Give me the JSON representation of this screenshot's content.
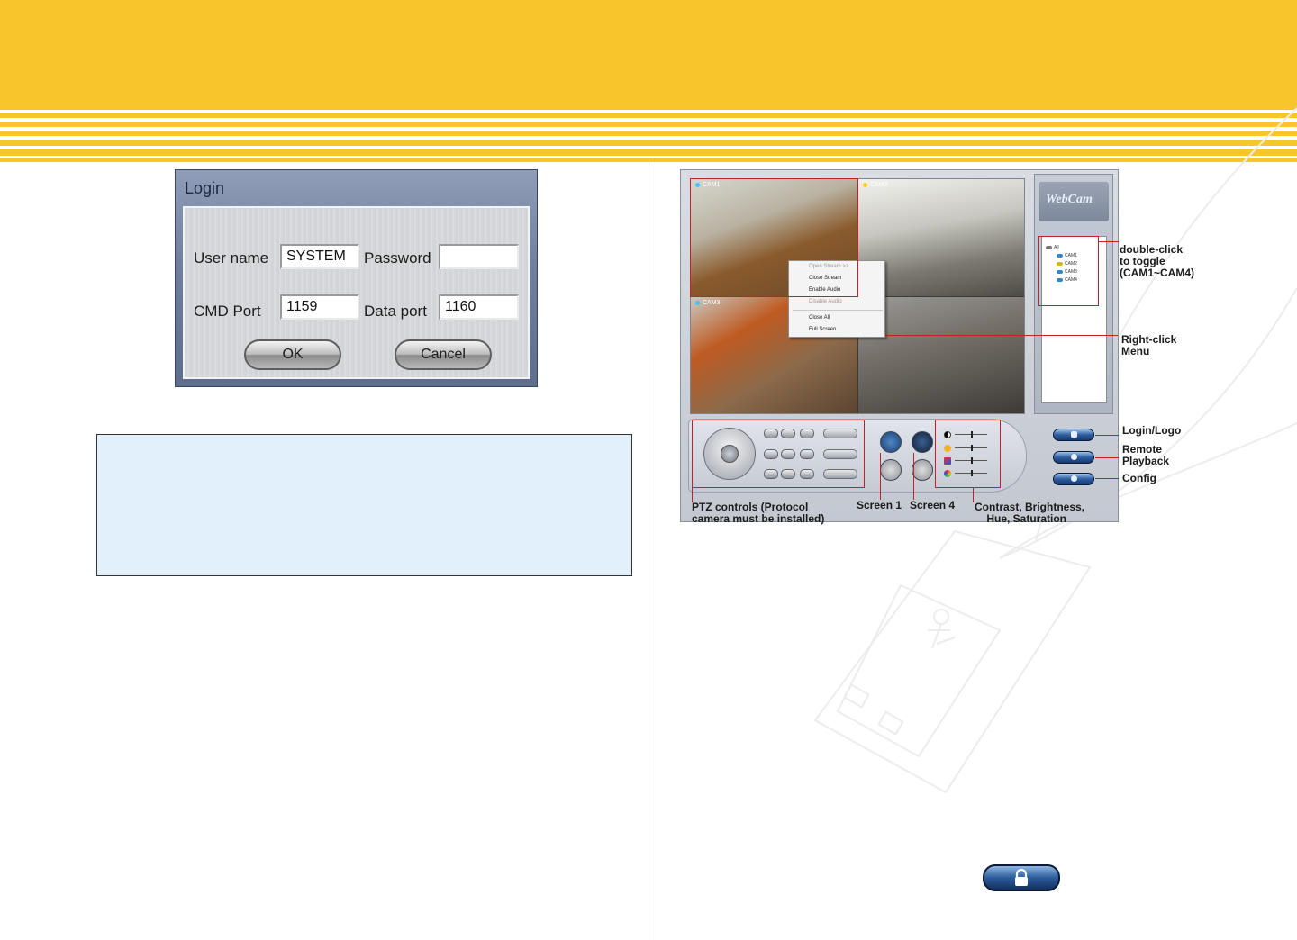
{
  "colors": {
    "banner": "#f8c52c",
    "note_box": "#e1f0fb",
    "annotation_red": "#c41f2a"
  },
  "login_dialog": {
    "title": "Login",
    "user_name_label": "User name",
    "user_name_value": "SYSTEM",
    "password_label": "Password",
    "password_value": "",
    "cmd_port_label": "CMD Port",
    "cmd_port_value": "1159",
    "data_port_label": "Data port",
    "data_port_value": "1160",
    "ok_label": "OK",
    "cancel_label": "Cancel"
  },
  "webcam_app": {
    "logo": "WebCam",
    "cameras": [
      "CAM1",
      "CAM2",
      "CAM3",
      "CAM4"
    ],
    "camera_tree": {
      "root": "All",
      "items": [
        "CAM1",
        "CAM2",
        "CAM3",
        "CAM4"
      ]
    },
    "context_menu": {
      "items": [
        "Open Stream >>",
        "Close Stream",
        "Enable Audio",
        "Disable Audio",
        "Close All",
        "Full Screen"
      ],
      "disabled": [
        "Open Stream >>",
        "Disable Audio"
      ]
    },
    "annotations": {
      "toggle": "double-click\nto toggle\n(CAM1~CAM4)",
      "right_click": "Right-click\nMenu",
      "login_logo": "Login/Logo",
      "remote_playback": "Remote\nPlayback",
      "config": "Config",
      "ptz": "PTZ controls (Protocol\ncamera must be installed)",
      "screen1": "Screen 1",
      "screen4": "Screen 4",
      "picture": "Contrast, Brightness,\n    Hue, Saturation"
    }
  },
  "lock_button_icon": "lock-icon"
}
